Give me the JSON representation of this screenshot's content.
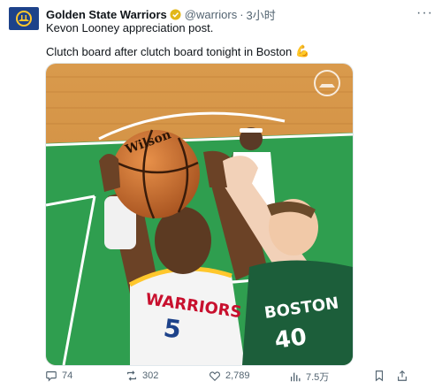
{
  "account": {
    "name": "Golden State Warriors",
    "handle": "@warriors",
    "separator": "·",
    "time": "3小时",
    "more": "···"
  },
  "tweet": {
    "line1": "Kevon Looney appreciation post.",
    "line2": "Clutch board after clutch board tonight in Boston",
    "emoji": "💪"
  },
  "media": {
    "jersey_front_text": "WARRIORS",
    "jersey_front_number": "5",
    "jersey_back_text": "BOSTON",
    "jersey_back_number": "40",
    "ball_text": "Wilson"
  },
  "actions": {
    "replies": "74",
    "retweets": "302",
    "likes": "2,789",
    "views": "7.5万"
  },
  "colors": {
    "brand_blue": "#1d428a",
    "brand_gold": "#ffc72c",
    "muted": "#536471",
    "court_green": "#2f9e4f",
    "celtics_green": "#1c5e3a"
  }
}
